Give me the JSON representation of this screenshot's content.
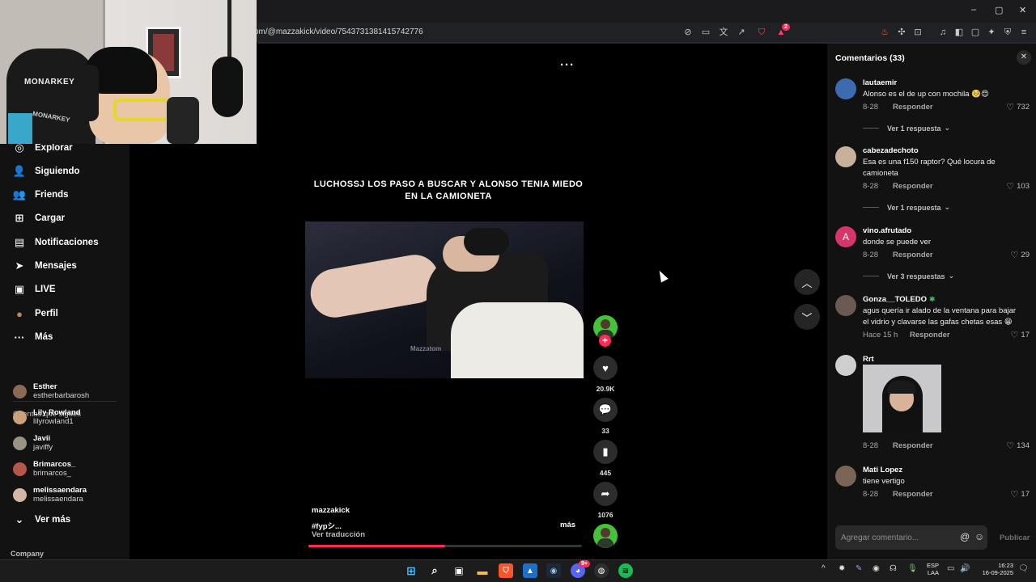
{
  "browser": {
    "url": "om/@mazzakick/video/7543731381415742776",
    "window_controls": [
      "–",
      "▢",
      "✕"
    ],
    "toolbar_icons": [
      "no-tracking-icon",
      "cast-icon",
      "translate-icon",
      "share-icon",
      "brave-shields-icon",
      "rewards-icon",
      "extension-fire-icon",
      "extensions-icon",
      "screenshot-icon",
      "media-icon",
      "sidebar-icon",
      "wallet-icon",
      "leo-ai-icon",
      "vpn-icon",
      "menu-icon"
    ],
    "rewards_badge": "2"
  },
  "sidebar": {
    "nav": [
      {
        "label": "Explorar",
        "icon": "compass-icon",
        "glyph": "◎"
      },
      {
        "label": "Siguiendo",
        "icon": "following-icon",
        "glyph": "👤",
        "dot": true
      },
      {
        "label": "Friends",
        "icon": "friends-icon",
        "glyph": "👥"
      },
      {
        "label": "Cargar",
        "icon": "upload-icon",
        "glyph": "⊞"
      },
      {
        "label": "Notificaciones",
        "icon": "inbox-icon",
        "glyph": "▤",
        "badge": "3"
      },
      {
        "label": "Mensajes",
        "icon": "messages-icon",
        "glyph": "➤",
        "badge": "36"
      },
      {
        "label": "LIVE",
        "icon": "live-icon",
        "glyph": "▣"
      },
      {
        "label": "Perfil",
        "icon": "profile-avatar-icon",
        "glyph": "●"
      },
      {
        "label": "Más",
        "icon": "more-icon",
        "glyph": "···"
      }
    ],
    "following_heading": "Cuentas que sigues",
    "following": [
      {
        "name": "Esther",
        "handle": "estherbarbarosh",
        "color": "#8a6a55"
      },
      {
        "name": "Lily Rowland",
        "handle": "lilyrowland1",
        "color": "#c9a27a"
      },
      {
        "name": "Javii",
        "handle": "javiffy",
        "color": "#9a9282"
      },
      {
        "name": "Brimarcos_",
        "handle": "brimarcos_",
        "color": "#b5564a"
      },
      {
        "name": "melissaendara",
        "handle": "melissaendara",
        "color": "#d1b7a4"
      }
    ],
    "see_more": "Ver más",
    "footer": "Company"
  },
  "video": {
    "overlay_text": "LUCHOSSJ LOS PASO A BUSCAR Y ALONSO TENIA MIEDO EN LA CAMIONETA",
    "watermark": "Mazzatom",
    "author": "mazzakick",
    "description": "#fypシ...",
    "translate": "Ver traducción",
    "more": "más",
    "more_menu": "···",
    "progress": 0.5,
    "stats": {
      "likes": "20.9K",
      "comments": "33",
      "saves": "445",
      "shares": "1076"
    },
    "accent": "#fe2c55"
  },
  "comments": {
    "title": "Comentarios (33)",
    "reply_label": "Responder",
    "items": [
      {
        "user": "lautaemir",
        "text": "Alonso es el de up con mochila 🥺😍",
        "date": "8-28",
        "likes": "732",
        "view": "Ver 1 respuesta",
        "avatar": "#3c6bb0"
      },
      {
        "user": "cabezadechoto",
        "text": "Esa es una f150 raptor? Qué locura de camioneta",
        "date": "8-28",
        "likes": "103",
        "view": "Ver 1 respuesta",
        "avatar": "#c8b09a"
      },
      {
        "user": "vino.afrutado",
        "text": "donde se puede ver",
        "date": "8-28",
        "likes": "29",
        "view": "Ver 3 respuestas",
        "avatar": "#d8356a",
        "initial": "A"
      },
      {
        "user": "Gonza__TOLEDO",
        "text": "agus quería ir alado de la ventana para bajar el vidrio y clavarse las gafas chetas esas 😁",
        "date": "Hace 15 h",
        "likes": "17",
        "avatar": "#6a5a52"
      },
      {
        "user": "Rrt",
        "text": "",
        "date": "8-28",
        "likes": "134",
        "avatar": "#cfcfcf"
      },
      {
        "user": "Mati Lopez",
        "text": "tiene vertigo",
        "date": "8-28",
        "likes": "17",
        "avatar": "#7a6456"
      }
    ],
    "input_placeholder": "Agregar comentario...",
    "post": "Publicar"
  },
  "taskbar": {
    "apps": [
      "windows-start-icon",
      "search-icon",
      "task-view-icon",
      "file-explorer-icon",
      "brave-browser-icon",
      "photos-icon",
      "steam-icon",
      "discord-icon",
      "obs-icon",
      "spotify-icon"
    ],
    "discord_badge": "9+",
    "lang": "ESP",
    "layout": "LAA",
    "time": "16:23",
    "date": "16-09-2025"
  }
}
